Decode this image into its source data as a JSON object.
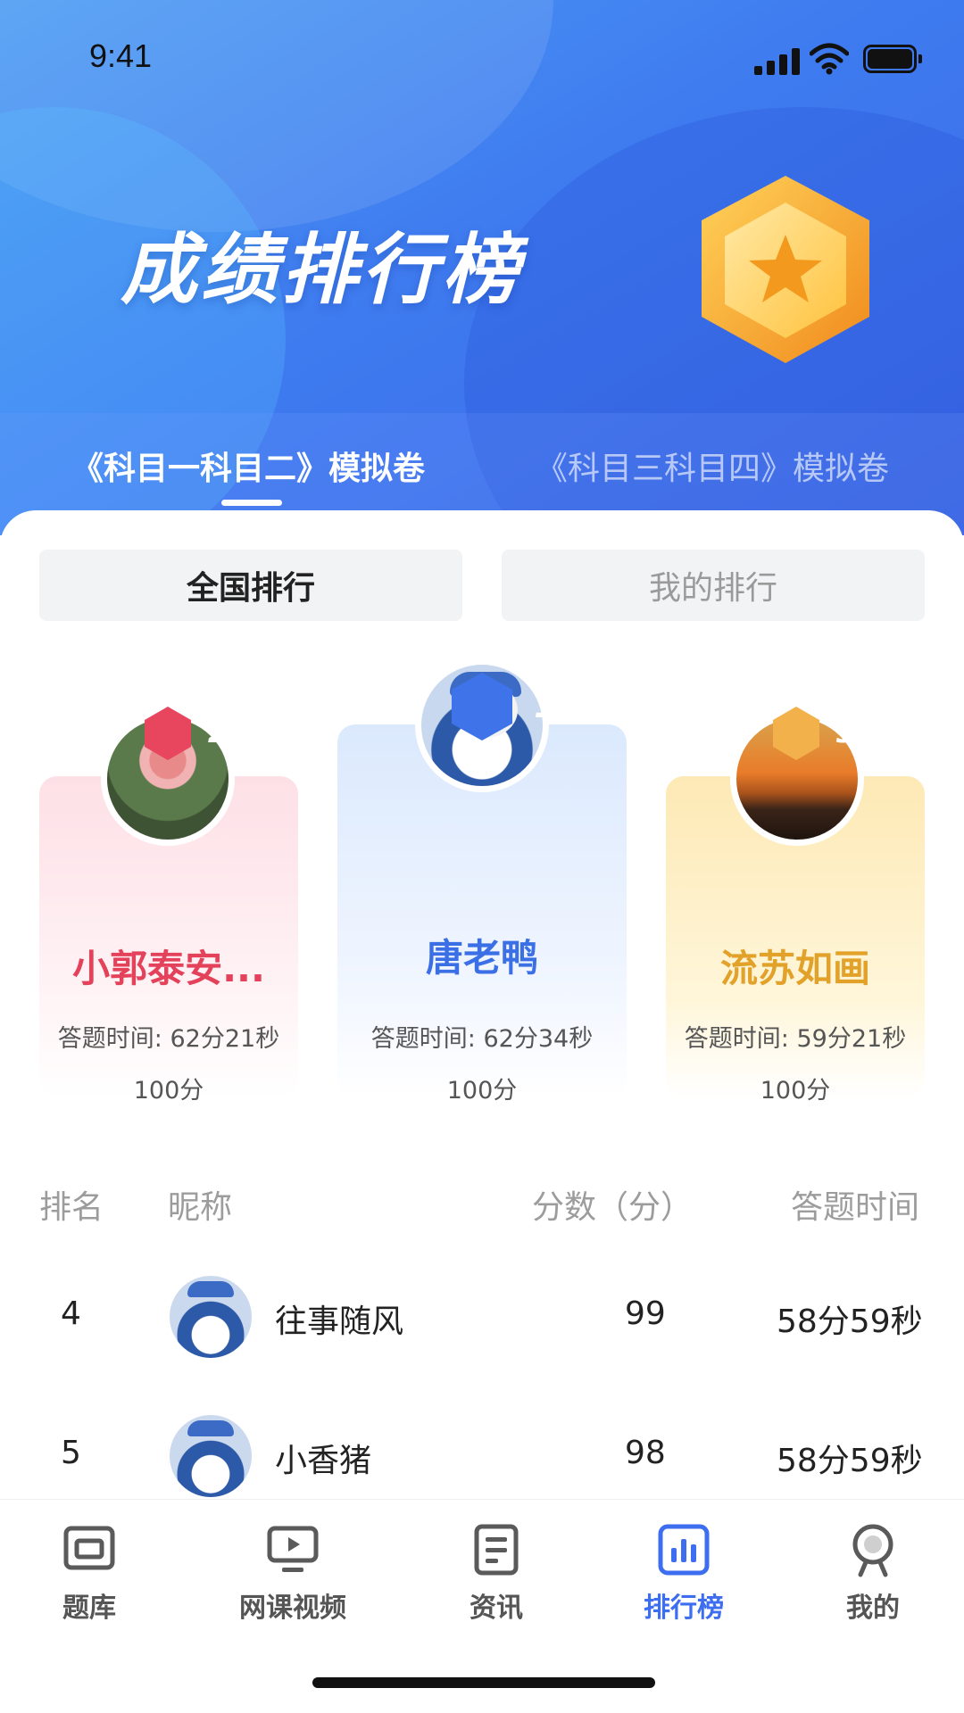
{
  "status": {
    "time": "9:41"
  },
  "hero": {
    "title": "成绩排行榜"
  },
  "exam_tabs": [
    {
      "label": "《科目一科目二》模拟卷",
      "active": true
    },
    {
      "label": "《科目三科目四》模拟卷",
      "active": false
    }
  ],
  "segments": [
    {
      "label": "全国排行",
      "active": true
    },
    {
      "label": "我的排行",
      "active": false
    }
  ],
  "podium": [
    {
      "rank": "1",
      "name": "唐老鸭",
      "time": "答题时间: 62分34秒",
      "score": "100分",
      "color": "#3b6fe6"
    },
    {
      "rank": "2",
      "name": "小郭泰安...",
      "time": "答题时间: 62分21秒",
      "score": "100分",
      "color": "#e4415b"
    },
    {
      "rank": "3",
      "name": "流苏如画",
      "time": "答题时间: 59分21秒",
      "score": "100分",
      "color": "#e2a229"
    }
  ],
  "table": {
    "headers": {
      "rank": "排名",
      "nickname": "昵称",
      "score": "分数（分）",
      "time": "答题时间"
    },
    "rows": [
      {
        "rank": "4",
        "name": "往事随风",
        "score": "99",
        "time": "58分59秒"
      },
      {
        "rank": "5",
        "name": "小香猪",
        "score": "98",
        "time": "58分59秒"
      }
    ]
  },
  "bottom_nav": [
    {
      "label": "题库",
      "icon": "question-bank-icon",
      "active": false
    },
    {
      "label": "网课视频",
      "icon": "video-monitor-icon",
      "active": false
    },
    {
      "label": "资讯",
      "icon": "news-document-icon",
      "active": false
    },
    {
      "label": "排行榜",
      "icon": "bar-chart-icon",
      "active": true
    },
    {
      "label": "我的",
      "icon": "profile-person-icon",
      "active": false
    }
  ],
  "colors": {
    "primary": "#3e6ef0",
    "second": "#e4415b",
    "third": "#e2a229"
  }
}
